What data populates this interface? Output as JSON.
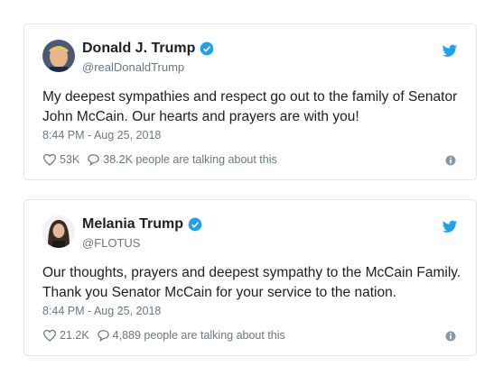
{
  "tweets": [
    {
      "name": "Donald J. Trump",
      "handle": "@realDonaldTrump",
      "text": "My deepest sympathies and respect go out to the family of Senator John McCain. Our hearts and prayers are with you!",
      "time": "8:44 PM - Aug 25, 2018",
      "likes": "53K",
      "talking": "38.2K people are talking about this",
      "icons": [
        "verified-icon",
        "twitter-bird-icon",
        "heart-icon",
        "comment-icon",
        "info-icon"
      ]
    },
    {
      "name": "Melania Trump",
      "handle": "@FLOTUS",
      "text": "Our thoughts, prayers and deepest sympathy to the McCain Family. Thank you Senator McCain for your service to the nation.",
      "time": "8:44 PM - Aug 25, 2018",
      "likes": "21.2K",
      "talking": "4,889 people are talking about this",
      "icons": [
        "verified-icon",
        "twitter-bird-icon",
        "heart-icon",
        "comment-icon",
        "info-icon"
      ]
    }
  ],
  "colors": {
    "accent": "#1da1f2",
    "muted": "#697882",
    "border": "#e1e8ed"
  }
}
